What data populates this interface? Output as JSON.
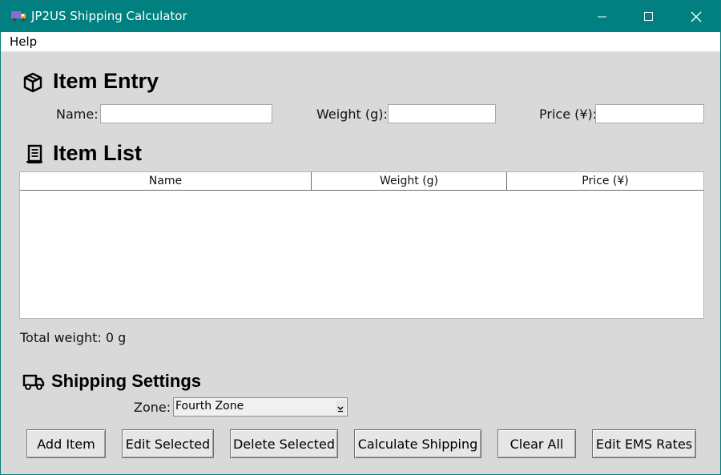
{
  "window": {
    "title": "JP2US Shipping Calculator"
  },
  "menu": {
    "help": "Help"
  },
  "item_entry": {
    "title": "Item Entry",
    "name_label": "Name:",
    "name_value": "",
    "weight_label": "Weight (g):",
    "weight_value": "",
    "price_label": "Price (¥):",
    "price_value": ""
  },
  "item_list": {
    "title": "Item List",
    "columns": [
      "Name",
      "Weight (g)",
      "Price (¥)"
    ],
    "rows": []
  },
  "total_weight": "Total weight: 0 g",
  "shipping": {
    "title": "Shipping Settings",
    "zone_label": "Zone:",
    "zone_value": "Fourth Zone"
  },
  "buttons": {
    "add": "Add Item",
    "edit": "Edit Selected",
    "delete": "Delete Selected",
    "calculate": "Calculate Shipping",
    "clear": "Clear All",
    "edit_rates": "Edit EMS Rates"
  },
  "colors": {
    "titlebar": "#008080",
    "background": "#d9d9d9"
  },
  "icons": {
    "app": "truck-icon",
    "item_entry": "package-icon",
    "item_list": "scroll-icon",
    "shipping": "truck-icon"
  }
}
